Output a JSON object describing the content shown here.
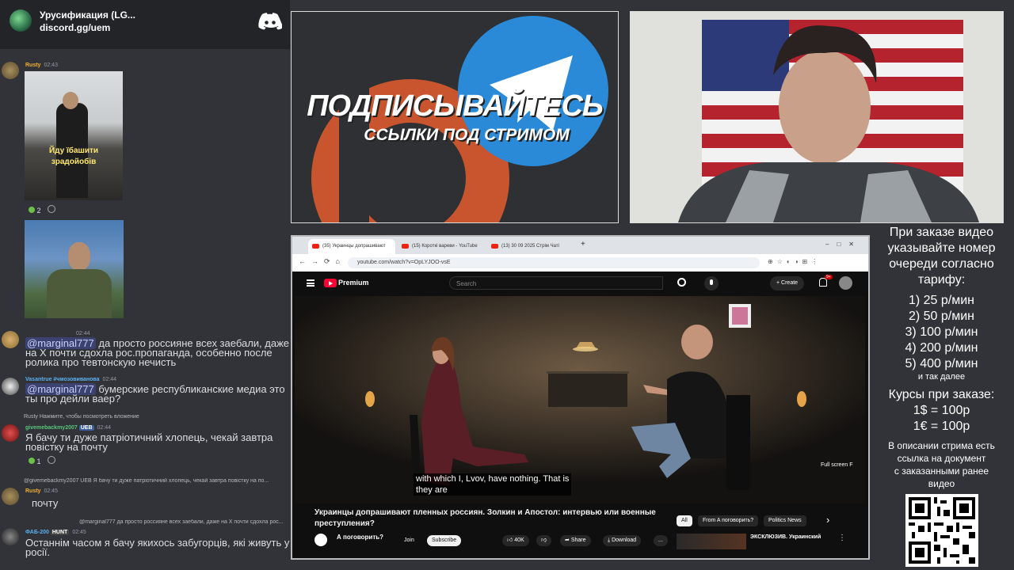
{
  "discord": {
    "server_name": "Урусификация (LG...",
    "server_link": "discord.gg/uem",
    "messages": [
      {
        "user": "Rusty",
        "time": "02:43"
      },
      {
        "reaction_count": "2"
      },
      {
        "user": "",
        "time": "02:44",
        "mention": "@marginal777",
        "text": "да просто россияне всех заебали, даже на X почти сдохла рос.пропаганда, особенно после ролика про тевтонскую нечисть"
      },
      {
        "user": "Vasantrue #чмозовиванова",
        "time": "02:44",
        "mention": "@marginal777",
        "text": "бумерские республиканские медиа это ты про дейли ваер?"
      },
      {
        "reply": "Rusty Нажмите, чтобы посмотреть вложение",
        "user": "givemebackmy2007",
        "badge": "UEB",
        "time": "02:44",
        "text": "Я бачу ти дуже патріотичний хлопець, чекай завтра повістку на почту",
        "reaction_count": "1"
      },
      {
        "reply": "@givemebackmy2007 UEB Я бачу ти дуже патріотичний хлопець, чекай завтра повістку на по...",
        "user": "Rusty",
        "time": "02:45",
        "text": "почту"
      },
      {
        "reply": "@marginal777 да просто россияне всех заебали, даже на X почти сдохла рос...",
        "user": "ФАБ-200",
        "badge": "HUNT",
        "time": "02:45",
        "text": "Останнім часом я бачу якихось забугорців, які живуть у росії."
      }
    ],
    "meme_caption": "Йду їбашити зрадойобів"
  },
  "promo": {
    "headline": "ПОДПИСЫВАЙТЕСЬ",
    "subline": "ССЫЛКИ ПОД СТРИМОМ"
  },
  "browser": {
    "tabs": [
      "(35) Украинцы допрашивают",
      "(15) Короткі вареви - YouTube",
      "(13) 30 09 2025 Стрім Чаті"
    ],
    "new_tab": "+",
    "url": "youtube.com/watch?v=OpLYJOO-vsE",
    "yt_brand": "Premium",
    "search_placeholder": "Search",
    "create_label": "Create",
    "notif_badge": "9+",
    "subtitle_line1": "with which I, Lvov, have nothing. That is",
    "subtitle_line2": "they are",
    "fullscreen_label": "Full screen",
    "fullscreen_key": "F",
    "video_title_line1": "Украинцы допрашивают пленных россиян. Золкин и Апостол: интервью или военные",
    "video_title_line2": "преступления?",
    "channel_name": "А поговорить?",
    "join_label": "Join",
    "subscribe_label": "Subscribe",
    "likes": "40K",
    "share_label": "Share",
    "download_label": "Download",
    "more_label": "...",
    "chips": [
      "All",
      "From A поговорить?",
      "Politics News"
    ],
    "related_title": "ЭКСКЛЮЗИВ. Украинский"
  },
  "side": {
    "order_lines": [
      "При заказе видео",
      "указывайте номер",
      "очереди согласно",
      "тарифу:"
    ],
    "tariffs": [
      "1) 25 р/мин",
      "2) 50 р/мин",
      "3) 100 р/мин",
      "4) 200 р/мин",
      "5) 400 р/мин"
    ],
    "and_so_on": "и так далее",
    "rates_title": "Курсы при заказе:",
    "rates": [
      "1$ = 100р",
      "1€ = 100р"
    ],
    "description_lines": [
      "В описании стрима есть",
      "ссылка на документ",
      "с заказанными ранее",
      "видео"
    ]
  },
  "colors": {
    "discord_bg": "#313338",
    "mention_bg": "#3c4270",
    "youtube_red": "#ff0033",
    "telegram_blue": "#2a8ad8",
    "promo_orange": "#c8552e"
  }
}
